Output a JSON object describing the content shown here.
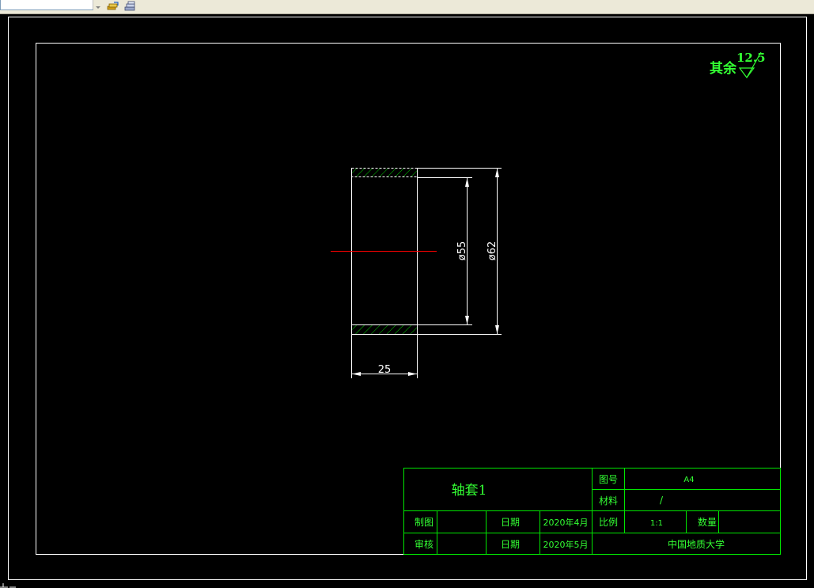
{
  "toolbar": {
    "layer_combo_value": "",
    "icons": [
      "layer-states-icon",
      "layer-previous-icon"
    ]
  },
  "drawing": {
    "roughness_prefix": "其余",
    "roughness_value": "12.5",
    "roughness_symbol": "roughness-triangle-icon",
    "dim_inner_diameter": "ø55",
    "dim_outer_diameter": "ø62",
    "dim_length": "25"
  },
  "title_block": {
    "part_name": "轴套1",
    "drawing_no_label": "图号",
    "drawing_no_value": "A4",
    "material_label": "材料",
    "material_value": "/",
    "drafter_label": "制图",
    "drafter_value": "",
    "date_label_1": "日期",
    "date_value_1": "2020年4月",
    "scale_label": "比例",
    "scale_value": "1:1",
    "quantity_label": "数量",
    "quantity_value": "",
    "checker_label": "审核",
    "checker_value": "",
    "date_label_2": "日期",
    "date_value_2": "2020年5月",
    "organization": "中国地质大学"
  },
  "colors": {
    "canvas_bg": "#000000",
    "frame_lines": "#ffffff",
    "annotation_green": "#33ff33",
    "title_block_lines": "#00e600",
    "hatch_green": "#00cc00",
    "centerline_red": "#ff0000"
  }
}
